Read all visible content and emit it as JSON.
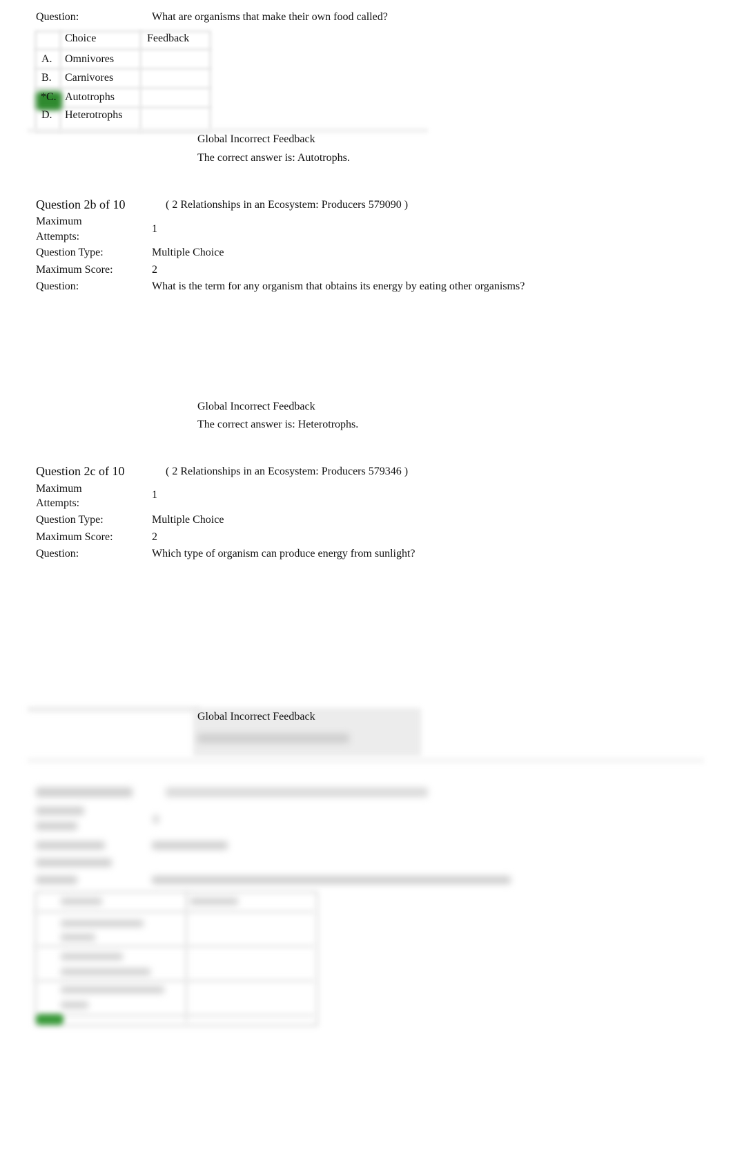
{
  "question_2a": {
    "question_label": "Question:",
    "question_text": "What are organisms that make their own food called?",
    "choices_table": {
      "headers": [
        "",
        "Choice",
        "Feedback"
      ],
      "rows": [
        {
          "letter": "A.",
          "choice": "Omnivores",
          "feedback": "",
          "correct": false
        },
        {
          "letter": "B.",
          "choice": "Carnivores",
          "feedback": "",
          "correct": false
        },
        {
          "letter": "*C.",
          "choice": "Autotrophs",
          "feedback": "",
          "correct": true
        },
        {
          "letter": "D.",
          "choice": "Heterotrophs",
          "feedback": "",
          "correct": false
        }
      ]
    },
    "global_feedback_title": "Global Incorrect Feedback",
    "global_feedback_text": "The correct answer is: Autotrophs."
  },
  "question_2b": {
    "heading": "Question 2b of 10",
    "source": "( 2 Relationships in an Ecosystem: Producers 579090 )",
    "max_attempts_label_line1": "Maximum",
    "max_attempts_label_line2": "Attempts:",
    "max_attempts_value": "1",
    "question_type_label": "Question Type:",
    "question_type_value": "Multiple Choice",
    "max_score_label": "Maximum Score:",
    "max_score_value": "2",
    "question_label": "Question:",
    "question_text": "What is the term for any organism that obtains its energy by eating other organisms?",
    "global_feedback_title": "Global Incorrect Feedback",
    "global_feedback_text": "The correct answer is: Heterotrophs."
  },
  "question_2c": {
    "heading": "Question 2c of 10",
    "source": "( 2 Relationships in an Ecosystem: Producers 579346 )",
    "max_attempts_label_line1": "Maximum",
    "max_attempts_label_line2": "Attempts:",
    "max_attempts_value": "1",
    "question_type_label": "Question Type:",
    "question_type_value": "Multiple Choice",
    "max_score_label": "Maximum Score:",
    "max_score_value": "2",
    "question_label": "Question:",
    "question_text": "Which type of organism can produce energy from sunlight?",
    "global_feedback_title": "Global Incorrect Feedback"
  },
  "colors": {
    "correct_highlight": "#2f8a2f",
    "text": "#111111"
  }
}
